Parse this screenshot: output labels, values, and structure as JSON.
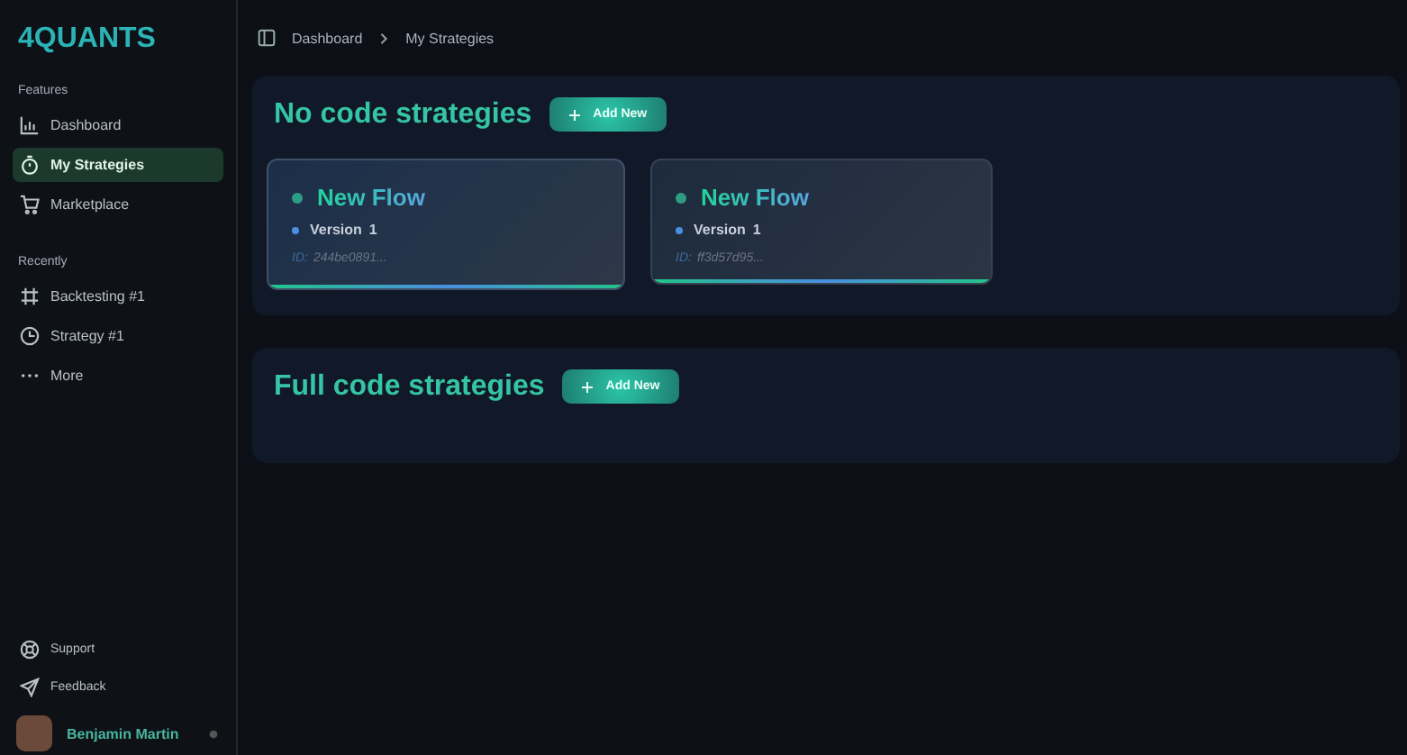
{
  "sidebar": {
    "logo": "4QUANTS",
    "groups": [
      {
        "title": "Features",
        "items": [
          {
            "label": "Dashboard",
            "kind": "chart",
            "selected": false
          },
          {
            "label": "My Strategies",
            "kind": "timer",
            "selected": true
          },
          {
            "label": "Marketplace",
            "kind": "cart",
            "selected": false
          }
        ]
      },
      {
        "title": "Recently",
        "items": [
          {
            "label": "Backtesting #1",
            "kind": "hash",
            "selected": false
          },
          {
            "label": "Strategy #1",
            "kind": "clock",
            "selected": false
          },
          {
            "label": "More",
            "kind": "dots",
            "selected": false
          }
        ]
      }
    ],
    "footer": [
      {
        "label": "Support",
        "kind": "lifebuoy"
      },
      {
        "label": "Feedback",
        "kind": "send"
      }
    ],
    "user": {
      "name": "Benjamin Martin"
    }
  },
  "breadcrumb": [
    "Dashboard",
    "My Strategies"
  ],
  "sections": [
    {
      "title": "No code strategies",
      "button": "Add New",
      "cards": [
        {
          "title": "New Flow",
          "version_label": "Version",
          "version": "1",
          "id_label": "ID:",
          "id": "244be0891...",
          "selected": true
        },
        {
          "title": "New Flow",
          "version_label": "Version",
          "version": "1",
          "id_label": "ID:",
          "id": "ff3d57d95...",
          "selected": false
        }
      ]
    },
    {
      "title": "Full code strategies",
      "button": "Add New"
    }
  ]
}
